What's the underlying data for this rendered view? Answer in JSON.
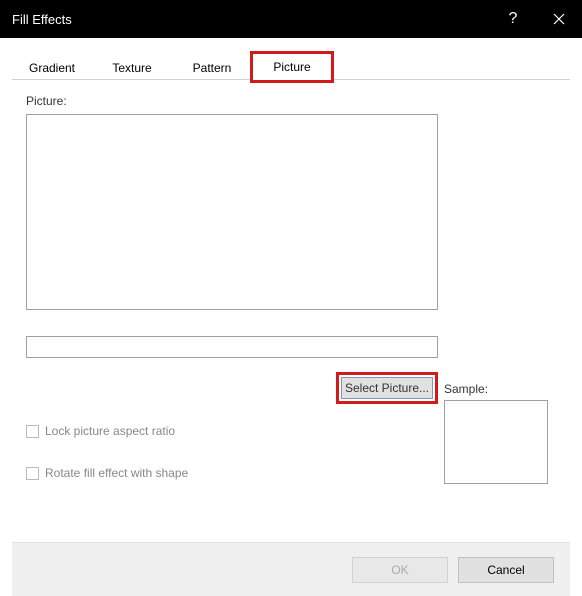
{
  "titlebar": {
    "title": "Fill Effects"
  },
  "tabs": {
    "gradient": "Gradient",
    "texture": "Texture",
    "pattern": "Pattern",
    "picture": "Picture"
  },
  "content": {
    "picture_label": "Picture:",
    "select_picture_label": "Select Picture...",
    "lock_aspect_label": "Lock picture aspect ratio",
    "rotate_label": "Rotate fill effect with shape",
    "sample_label": "Sample:"
  },
  "footer": {
    "ok_label": "OK",
    "cancel_label": "Cancel"
  }
}
